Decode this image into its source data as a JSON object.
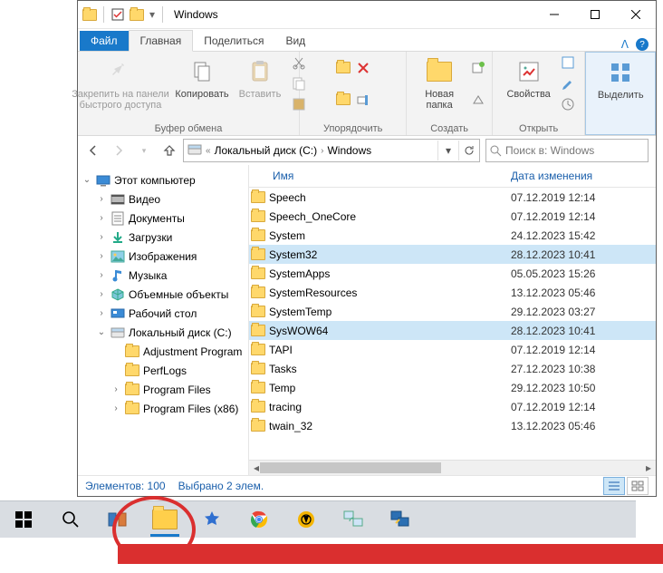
{
  "title": "Windows",
  "ribbon_tabs": {
    "file": "Файл",
    "home": "Главная",
    "share": "Поделиться",
    "view": "Вид"
  },
  "ribbon": {
    "clipboard": {
      "pin": "Закрепить на панели\nбыстрого доступа",
      "copy": "Копировать",
      "paste": "Вставить",
      "label": "Буфер обмена"
    },
    "organize": {
      "label": "Упорядочить"
    },
    "new": {
      "newfolder": "Новая\nпапка",
      "label": "Создать"
    },
    "open": {
      "props": "Свойства",
      "label": "Открыть"
    },
    "select": {
      "select": "Выделить"
    }
  },
  "breadcrumbs": {
    "b1": "Локальный диск (C:)",
    "b2": "Windows"
  },
  "search_placeholder": "Поиск в: Windows",
  "columns": {
    "name": "Имя",
    "date": "Дата изменения"
  },
  "tree": [
    {
      "label": "Этот компьютер",
      "level": 0,
      "exp": "open",
      "icon": "pc"
    },
    {
      "label": "Видео",
      "level": 1,
      "exp": "closed",
      "icon": "video"
    },
    {
      "label": "Документы",
      "level": 1,
      "exp": "closed",
      "icon": "docs"
    },
    {
      "label": "Загрузки",
      "level": 1,
      "exp": "closed",
      "icon": "down"
    },
    {
      "label": "Изображения",
      "level": 1,
      "exp": "closed",
      "icon": "pics"
    },
    {
      "label": "Музыка",
      "level": 1,
      "exp": "closed",
      "icon": "music"
    },
    {
      "label": "Объемные объекты",
      "level": 1,
      "exp": "closed",
      "icon": "3d"
    },
    {
      "label": "Рабочий стол",
      "level": 1,
      "exp": "closed",
      "icon": "desk"
    },
    {
      "label": "Локальный диск (C:)",
      "level": 1,
      "exp": "open",
      "icon": "drive"
    },
    {
      "label": "Adjustment Program",
      "level": 2,
      "exp": "none",
      "icon": "folder"
    },
    {
      "label": "PerfLogs",
      "level": 2,
      "exp": "none",
      "icon": "folder"
    },
    {
      "label": "Program Files",
      "level": 2,
      "exp": "closed",
      "icon": "folder"
    },
    {
      "label": "Program Files (x86)",
      "level": 2,
      "exp": "closed",
      "icon": "folder"
    }
  ],
  "files": [
    {
      "name": "Speech",
      "date": "07.12.2019 12:14",
      "sel": false
    },
    {
      "name": "Speech_OneCore",
      "date": "07.12.2019 12:14",
      "sel": false
    },
    {
      "name": "System",
      "date": "24.12.2023 15:42",
      "sel": false
    },
    {
      "name": "System32",
      "date": "28.12.2023 10:41",
      "sel": true
    },
    {
      "name": "SystemApps",
      "date": "05.05.2023 15:26",
      "sel": false
    },
    {
      "name": "SystemResources",
      "date": "13.12.2023 05:46",
      "sel": false
    },
    {
      "name": "SystemTemp",
      "date": "29.12.2023 03:27",
      "sel": false
    },
    {
      "name": "SysWOW64",
      "date": "28.12.2023 10:41",
      "sel": true
    },
    {
      "name": "TAPI",
      "date": "07.12.2019 12:14",
      "sel": false
    },
    {
      "name": "Tasks",
      "date": "27.12.2023 10:38",
      "sel": false
    },
    {
      "name": "Temp",
      "date": "29.12.2023 10:50",
      "sel": false
    },
    {
      "name": "tracing",
      "date": "07.12.2019 12:14",
      "sel": false
    },
    {
      "name": "twain_32",
      "date": "13.12.2023 05:46",
      "sel": false
    }
  ],
  "status": {
    "count": "Элементов: 100",
    "selected": "Выбрано 2 элем."
  }
}
